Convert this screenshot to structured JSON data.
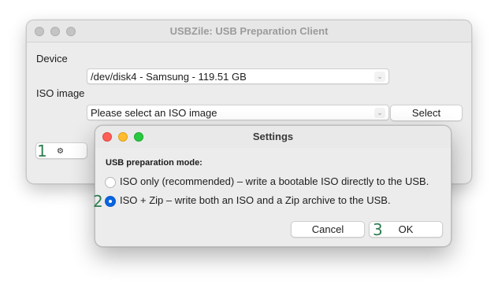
{
  "main_window": {
    "title": "USBZile: USB Preparation Client",
    "device_label": "Device",
    "device_value": "/dev/disk4 - Samsung - 119.51 GB",
    "iso_label": "ISO image",
    "iso_placeholder": "Please select an ISO image",
    "select_button": "Select",
    "settings_button_icon": "⚙"
  },
  "settings_dialog": {
    "title": "Settings",
    "section_label": "USB preparation mode:",
    "options": [
      {
        "label": "ISO only (recommended) – write a bootable ISO directly to the USB.",
        "selected": false
      },
      {
        "label": "ISO + Zip – write both an ISO and a Zip archive to the USB.",
        "selected": true
      }
    ],
    "cancel_button": "Cancel",
    "ok_button": "OK"
  },
  "annotations": [
    "1",
    "2",
    "3"
  ],
  "icons": {
    "settings": "gear-icon",
    "dropdown": "chevron-updown-icon"
  },
  "colors": {
    "accent": "#0a64e0",
    "annotation": "#2e7d4f",
    "close": "#ff5f57",
    "minimize": "#febc2e",
    "zoom": "#28c840"
  }
}
